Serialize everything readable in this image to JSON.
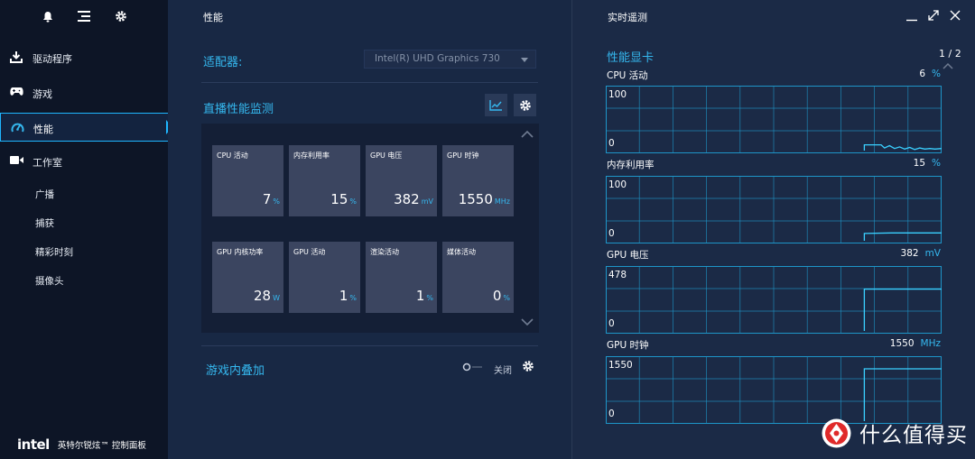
{
  "sidebar": {
    "items": [
      {
        "label": "驱动程序",
        "icon": "download-icon"
      },
      {
        "label": "游戏",
        "icon": "gamepad-icon"
      },
      {
        "label": "性能",
        "icon": "speedometer-icon",
        "active": true
      },
      {
        "label": "工作室",
        "icon": "video-camera-icon"
      }
    ],
    "sub_items": [
      "广播",
      "捕获",
      "精彩时刻",
      "摄像头"
    ],
    "brand": {
      "logo": "intel",
      "name": "英特尔锐炫™ 控制面板"
    }
  },
  "performance": {
    "title": "性能",
    "adapter_label": "适配器:",
    "adapter_value": "Intel(R) UHD Graphics 730",
    "stream_title": "直播性能监测",
    "tiles": [
      {
        "label": "CPU 活动",
        "value": "7",
        "unit": "%"
      },
      {
        "label": "内存利用率",
        "value": "15",
        "unit": "%"
      },
      {
        "label": "GPU 电压",
        "value": "382",
        "unit": "mV"
      },
      {
        "label": "GPU 时钟",
        "value": "1550",
        "unit": "MHz"
      },
      {
        "label": "GPU 内核功率",
        "value": "28",
        "unit": "W"
      },
      {
        "label": "GPU 活动",
        "value": "1",
        "unit": "%"
      },
      {
        "label": "渲染活动",
        "value": "1",
        "unit": "%"
      },
      {
        "label": "媒体活动",
        "value": "0",
        "unit": "%"
      }
    ],
    "overlay_title": "游戏内叠加",
    "overlay_state": "关闭"
  },
  "telemetry": {
    "title": "实时遥测",
    "subtitle": "性能显卡",
    "page": "1 / 2",
    "graphs": [
      {
        "label": "CPU 活动",
        "value": "6",
        "unit": "%",
        "ymax": "100",
        "ymin": "0",
        "series": [
          [
            0.77,
            0
          ],
          [
            0.77,
            0.11
          ],
          [
            0.82,
            0.11
          ],
          [
            0.83,
            0.05
          ],
          [
            0.845,
            0.095
          ],
          [
            0.86,
            0.04
          ],
          [
            0.875,
            0.07
          ],
          [
            0.89,
            0.03
          ],
          [
            0.905,
            0.06
          ],
          [
            0.92,
            0.02
          ],
          [
            0.935,
            0.05
          ],
          [
            0.95,
            0.03
          ],
          [
            0.965,
            0.04
          ],
          [
            0.98,
            0.03
          ],
          [
            1,
            0.04
          ]
        ]
      },
      {
        "label": "内存利用率",
        "value": "15",
        "unit": "%",
        "ymax": "100",
        "ymin": "0",
        "series": [
          [
            0.77,
            0
          ],
          [
            0.77,
            0.14
          ],
          [
            0.85,
            0.15
          ],
          [
            1,
            0.15
          ]
        ]
      },
      {
        "label": "GPU 电压",
        "value": "382",
        "unit": "mV",
        "ymax": "478",
        "ymin": "0",
        "series": [
          [
            0.77,
            0
          ],
          [
            0.77,
            0.8
          ],
          [
            1,
            0.8
          ]
        ]
      },
      {
        "label": "GPU 时钟",
        "value": "1550",
        "unit": "MHz",
        "ymax": "1550",
        "ymin": "0",
        "series": [
          [
            0.77,
            0
          ],
          [
            0.77,
            1
          ],
          [
            1,
            1
          ]
        ]
      }
    ]
  },
  "watermark": {
    "text": "什么值得买"
  },
  "colors": {
    "accent": "#35b8ef",
    "active_border": "#1fb6ff",
    "sidebar_bg": "#0d1526",
    "panel_bg": "#182844"
  }
}
